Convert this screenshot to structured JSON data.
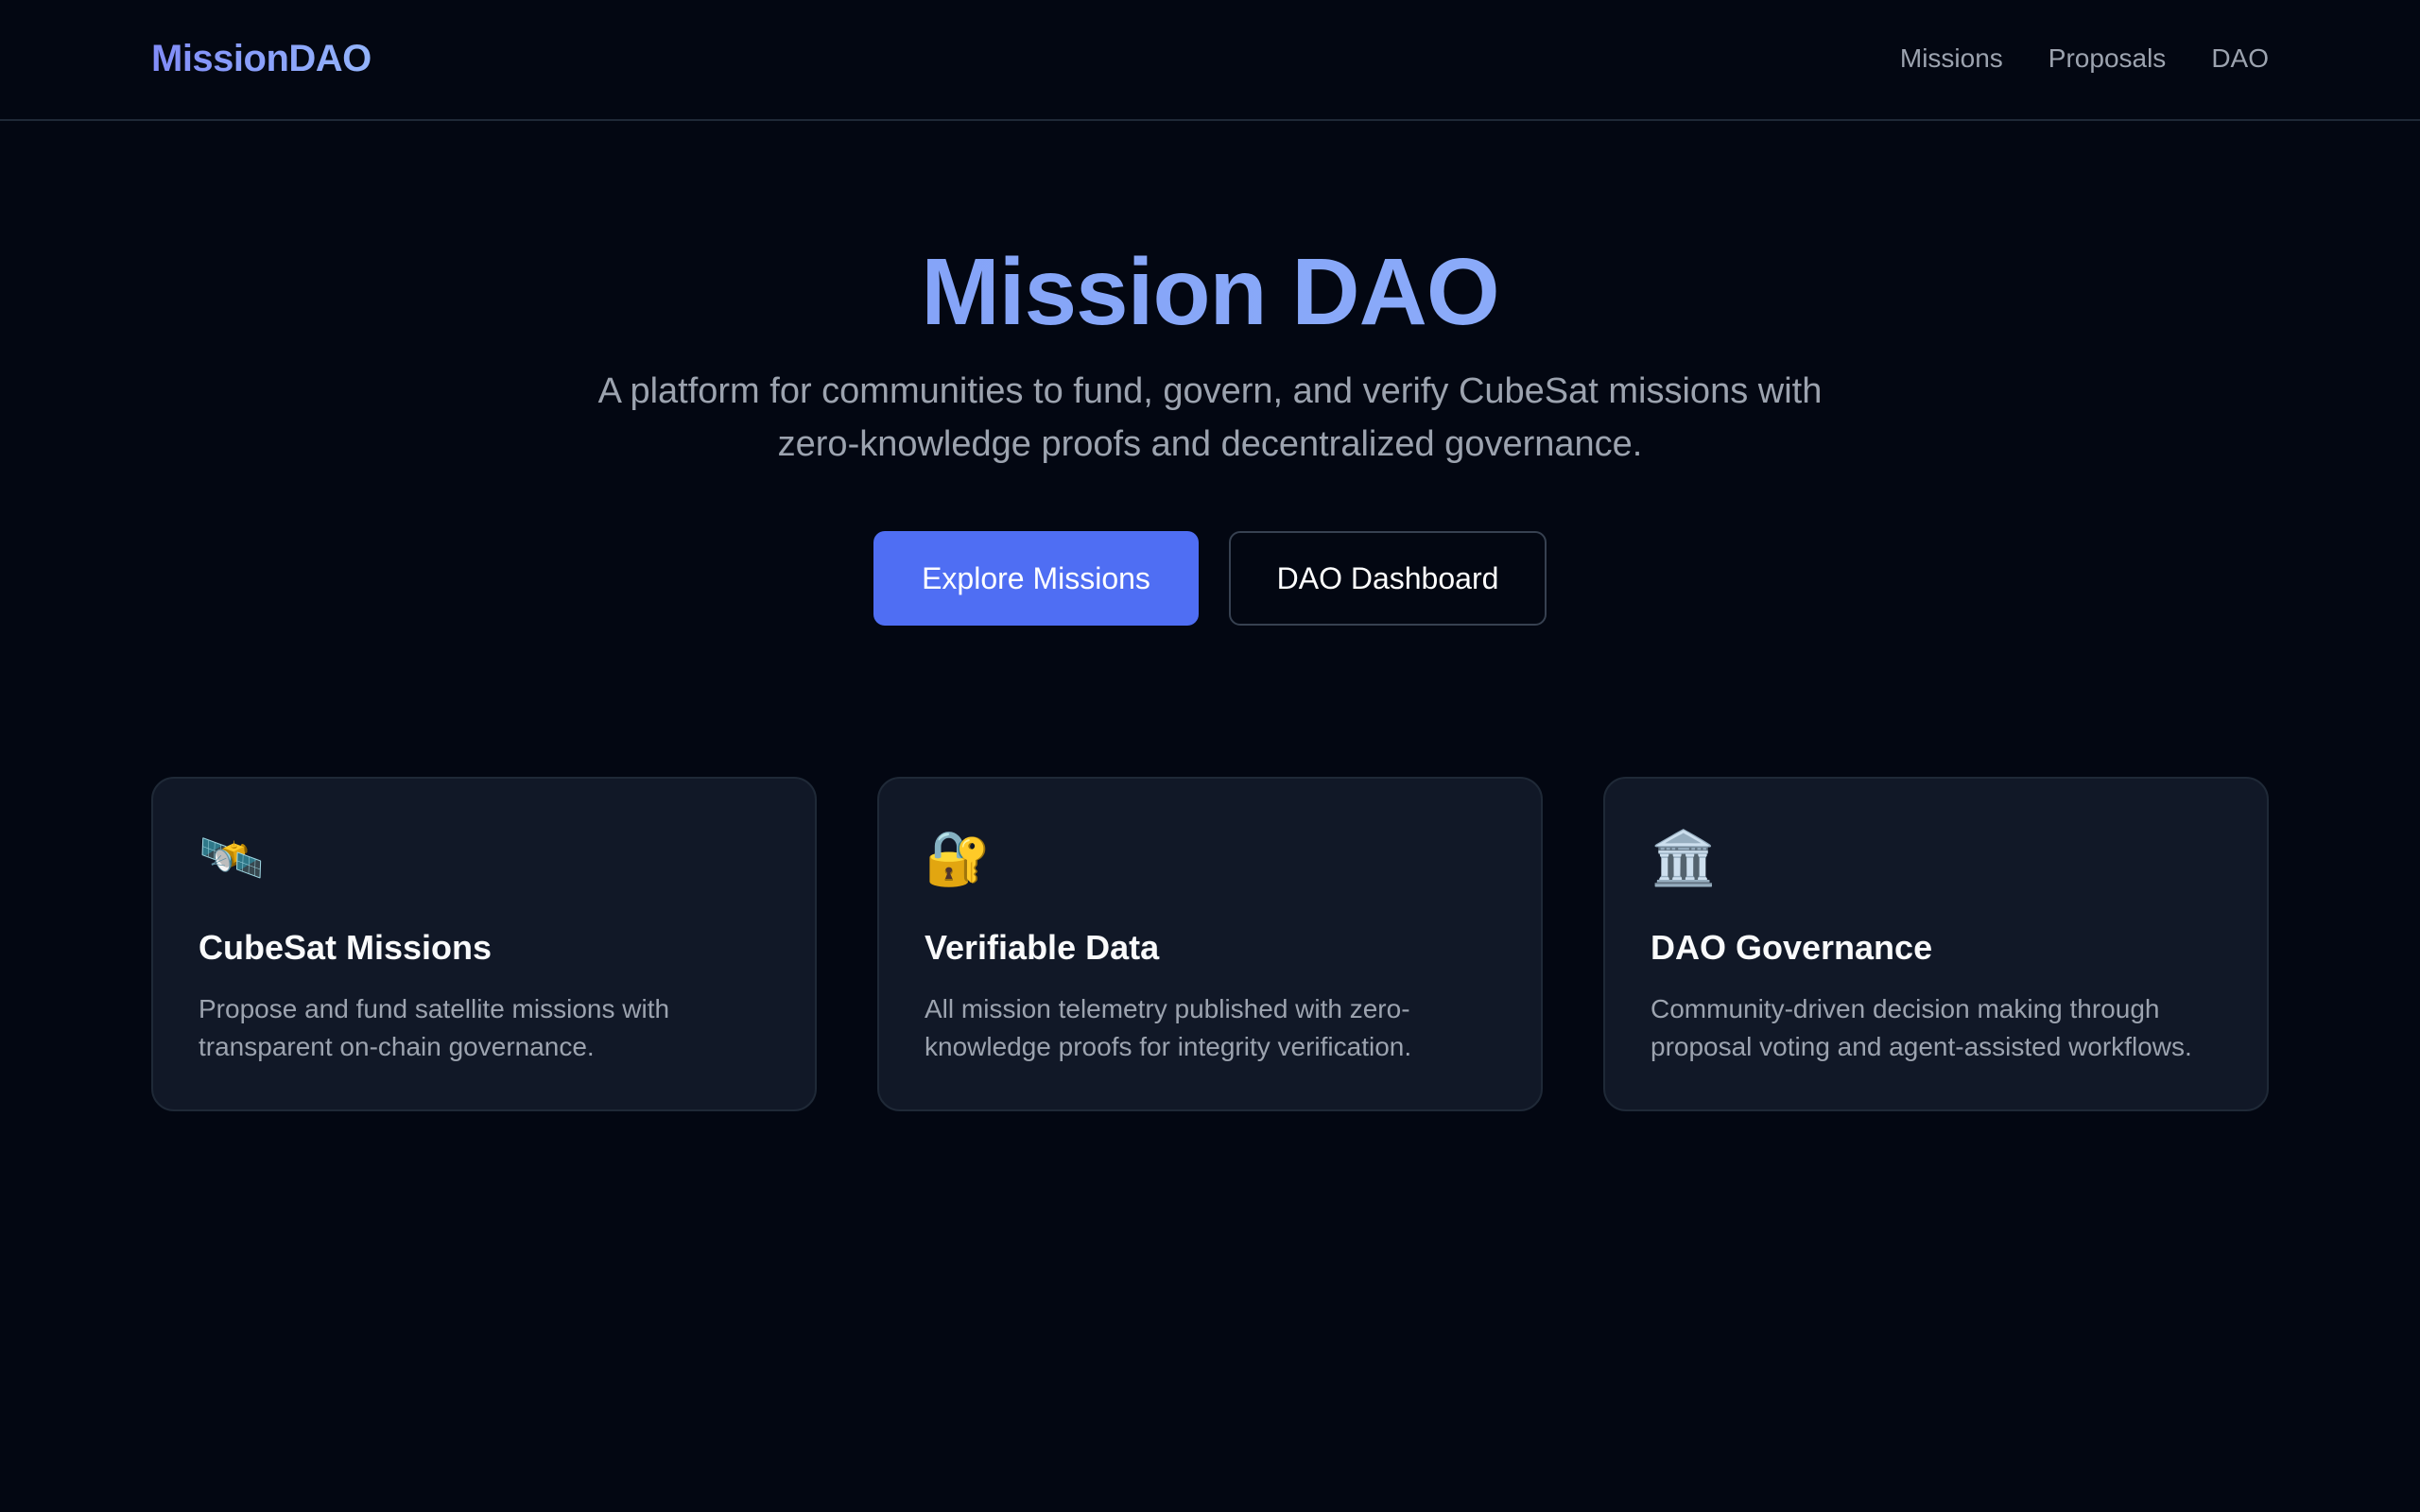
{
  "header": {
    "brand": "MissionDAO",
    "nav": [
      "Missions",
      "Proposals",
      "DAO"
    ]
  },
  "hero": {
    "title": "Mission DAO",
    "subtitle": "A platform for communities to fund, govern, and verify CubeSat missions with zero-knowledge proofs and decentralized governance.",
    "primary_button": "Explore Missions",
    "secondary_button": "DAO Dashboard"
  },
  "features": [
    {
      "icon": "satellite-icon",
      "glyph": "🛰️",
      "title": "CubeSat Missions",
      "description": "Propose and fund satellite missions with transparent on-chain governance."
    },
    {
      "icon": "lock-key-icon",
      "glyph": "🔐",
      "title": "Verifiable Data",
      "description": "All mission telemetry published with zero-knowledge proofs for integrity verification."
    },
    {
      "icon": "classical-building-icon",
      "glyph": "🏛️",
      "title": "DAO Governance",
      "description": "Community-driven decision making through proposal voting and agent-assisted workflows."
    }
  ],
  "colors": {
    "background": "#030712",
    "card": "#111827",
    "accent": "#4f6ef3",
    "brand": "#818cf8"
  }
}
